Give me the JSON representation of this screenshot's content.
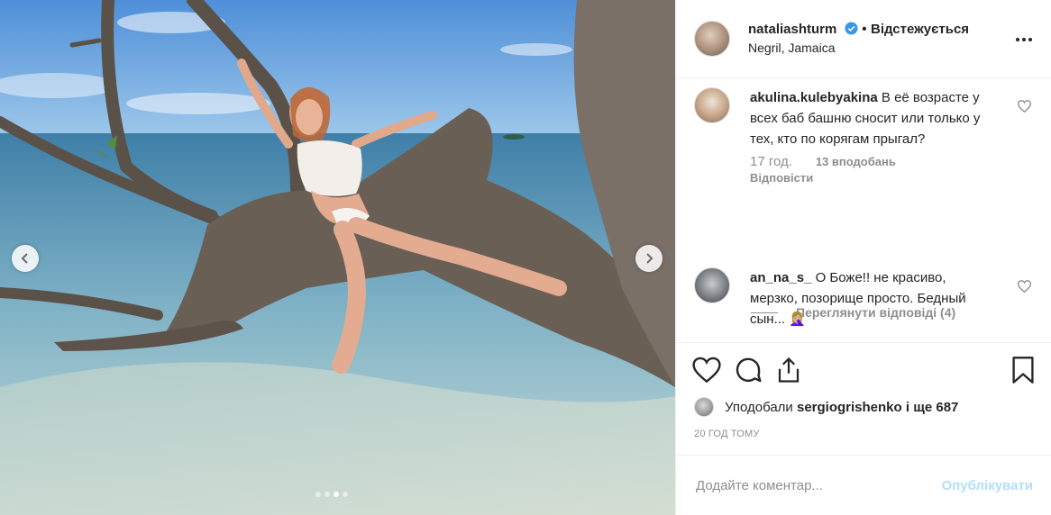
{
  "post": {
    "author": {
      "username": "nataliashturm",
      "verified": true,
      "follow_status": "Відстежується",
      "separator": "•",
      "location": "Negril, Jamaica"
    },
    "media": {
      "carousel_total": 4,
      "carousel_active_index": 2
    },
    "comments": [
      {
        "username": "akulina.kulebyakina",
        "text": "В её возрасте у всех баб башню сносит или только у тех, кто по корягам прыгал?",
        "time": "17 год.",
        "likes": "13 вподобань",
        "reply_label": "Відповісти",
        "view_replies": "Переглянути відповіді (4)"
      },
      {
        "username": "an_na_s_",
        "text": "О Боже!! не красиво, мерзко, позорище просто. Бедный сын... 🤦🏼‍♀️"
      }
    ],
    "liked_by": {
      "prefix": "Уподобали",
      "user": "sergiogrishenko",
      "suffix": "і ще 687"
    },
    "date": "20 ГОД ТОМУ",
    "add_comment": {
      "placeholder": "Додайте коментар...",
      "publish_label": "Опублікувати"
    }
  },
  "colors": {
    "verified_blue": "#3897f0",
    "publish_disabled": "#b2dffc",
    "meta_gray": "#8e8e8e"
  },
  "icons": [
    "verified-badge-icon",
    "more-options-icon",
    "heart-icon",
    "comment-icon",
    "share-icon",
    "bookmark-icon",
    "chevron-left-icon",
    "chevron-right-icon"
  ]
}
